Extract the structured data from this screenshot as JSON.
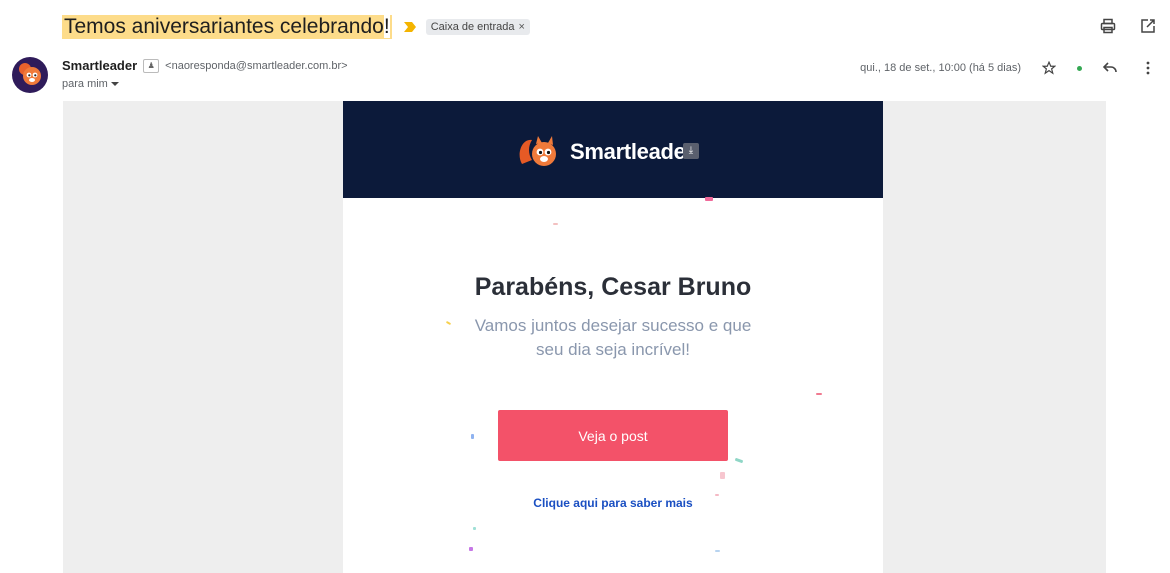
{
  "email": {
    "subject_prefix": "Temos aniversariantes celebrando",
    "subject_suffix": "!",
    "label": "Caixa de entrada",
    "label_remove": "×",
    "sender_name": "Smartleader",
    "sender_email": "<naoresponda@smartleader.com.br>",
    "recipient": "para mim",
    "date": "qui., 18 de set., 10:00 (há 5 dias)"
  },
  "body": {
    "logo_text": "Smartleader",
    "title": "Parabéns, Cesar Bruno",
    "subtitle": "Vamos juntos desejar sucesso e que seu dia seja incrível!",
    "cta_label": "Veja o post",
    "more_link": "Clique aqui para saber mais"
  },
  "colors": {
    "header_bg": "#0c1a3a",
    "cta_bg": "#f35269",
    "link": "#1a4fc2",
    "subject_highlight": "#fddc8a"
  },
  "icons": {
    "print": "print-icon",
    "open_new": "open-in-new-icon",
    "star": "star-icon",
    "reply": "reply-icon",
    "more": "more-vert-icon",
    "importance": "importance-marker-icon",
    "download": "download-icon"
  }
}
